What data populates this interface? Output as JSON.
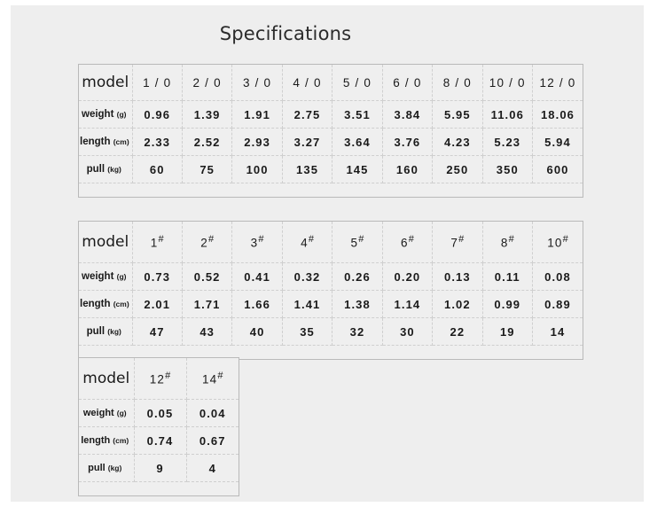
{
  "page": {
    "title": "Specifications",
    "background_color": "#eeeeee",
    "border_color": "#b9b9b9",
    "grid_color": "#cfcfcf"
  },
  "row_labels": {
    "model": "model",
    "weight": "weight",
    "weight_unit": "(g)",
    "length": "length",
    "length_unit": "(cm)",
    "pull": "pull",
    "pull_unit": "(kg)"
  },
  "tables": [
    {
      "id": "table-1",
      "models": [
        "1 / 0",
        "2 / 0",
        "3 / 0",
        "4 / 0",
        "5 / 0",
        "6 / 0",
        "8 / 0",
        "10 / 0",
        "12 / 0"
      ],
      "weight": [
        "0.96",
        "1.39",
        "1.91",
        "2.75",
        "3.51",
        "3.84",
        "5.95",
        "11.06",
        "18.06"
      ],
      "length": [
        "2.33",
        "2.52",
        "2.93",
        "3.27",
        "3.64",
        "3.76",
        "4.23",
        "5.23",
        "5.94"
      ],
      "pull": [
        "60",
        "75",
        "100",
        "135",
        "145",
        "160",
        "250",
        "350",
        "600"
      ]
    },
    {
      "id": "table-2",
      "models": [
        "1",
        "2",
        "3",
        "4",
        "5",
        "6",
        "7",
        "8",
        "10"
      ],
      "model_suffix": "#",
      "weight": [
        "0.73",
        "0.52",
        "0.41",
        "0.32",
        "0.26",
        "0.20",
        "0.13",
        "0.11",
        "0.08"
      ],
      "length": [
        "2.01",
        "1.71",
        "1.66",
        "1.41",
        "1.38",
        "1.14",
        "1.02",
        "0.99",
        "0.89"
      ],
      "pull": [
        "47",
        "43",
        "40",
        "35",
        "32",
        "30",
        "22",
        "19",
        "14"
      ]
    },
    {
      "id": "table-3",
      "models": [
        "12",
        "14"
      ],
      "model_suffix": "#",
      "weight": [
        "0.05",
        "0.04"
      ],
      "length": [
        "0.74",
        "0.67"
      ],
      "pull": [
        "9",
        "4"
      ]
    }
  ]
}
